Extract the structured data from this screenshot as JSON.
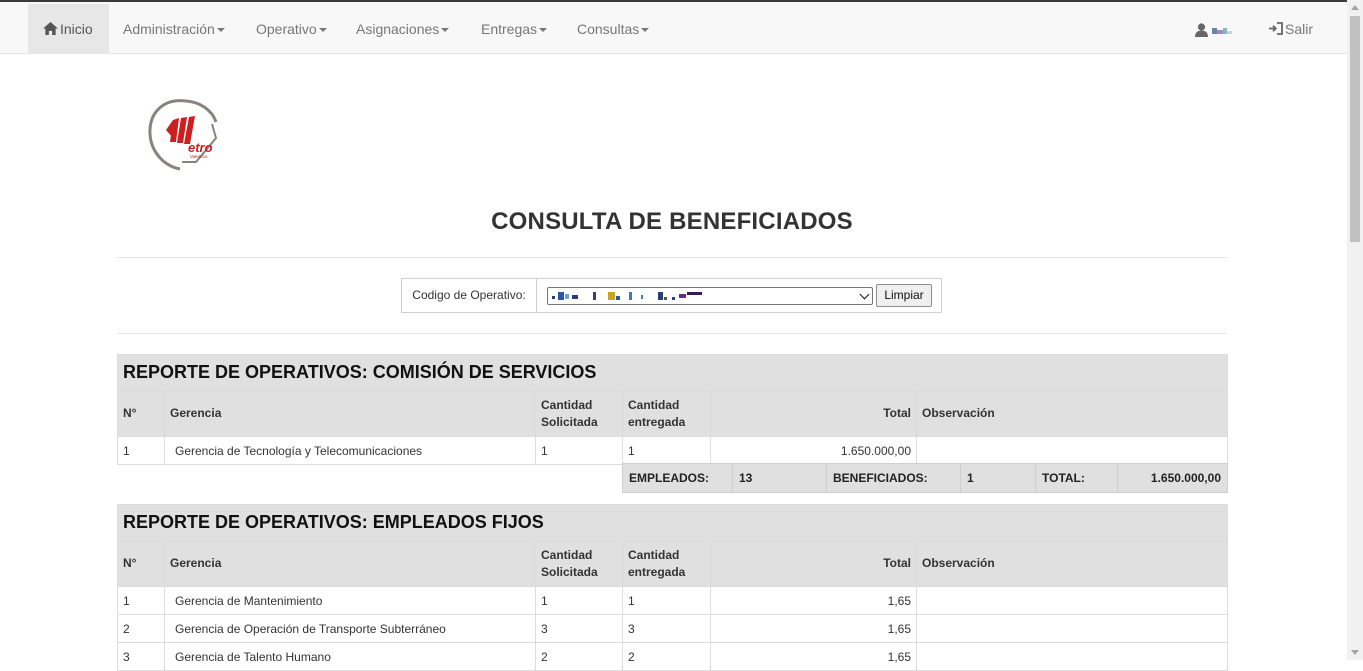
{
  "navbar": {
    "home": "Inicio",
    "menus": [
      "Administración",
      "Operativo",
      "Asignaciones",
      "Entregas",
      "Consultas"
    ],
    "logout": "Salir"
  },
  "page": {
    "title": "CONSULTA DE BENEFICIADOS"
  },
  "filter": {
    "label": "Codigo de Operativo:",
    "clear_button": "Limpiar"
  },
  "columns": {
    "num": "N°",
    "gerencia": "Gerencia",
    "solicitada": "Cantidad Solicitada",
    "entregada": "Cantidad entregada",
    "total": "Total",
    "observacion": "Observación"
  },
  "report1": {
    "title": "REPORTE DE OPERATIVOS: COMISIÓN DE SERVICIOS",
    "rows": [
      {
        "num": "1",
        "gerencia": "Gerencia de Tecnología y Telecomunicaciones",
        "solicitada": "1",
        "entregada": "1",
        "total": "1.650.000,00",
        "observacion": ""
      }
    ],
    "summary": {
      "empleados_label": "EMPLEADOS:",
      "empleados": "13",
      "beneficiados_label": "BENEFICIADOS:",
      "beneficiados": "1",
      "total_label": "TOTAL:",
      "total": "1.650.000,00"
    }
  },
  "report2": {
    "title": "REPORTE DE OPERATIVOS: EMPLEADOS FIJOS",
    "rows": [
      {
        "num": "1",
        "gerencia": "Gerencia de Mantenimiento",
        "solicitada": "1",
        "entregada": "1",
        "total": "1,65",
        "observacion": ""
      },
      {
        "num": "2",
        "gerencia": "Gerencia de Operación de Transporte Subterráneo",
        "solicitada": "3",
        "entregada": "3",
        "total": "1,65",
        "observacion": ""
      },
      {
        "num": "3",
        "gerencia": "Gerencia de Talento Humano",
        "solicitada": "2",
        "entregada": "2",
        "total": "1,65",
        "observacion": ""
      }
    ]
  },
  "logo": {
    "text": "etro",
    "subtext": "Valencia"
  },
  "icons": {
    "home": "home-icon",
    "user": "user-icon",
    "logout": "logout-icon"
  }
}
